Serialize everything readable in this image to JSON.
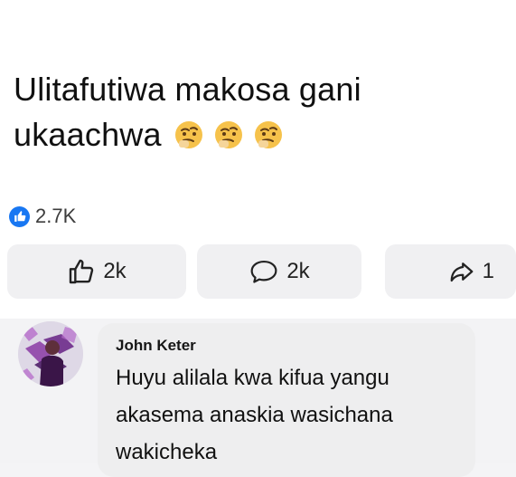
{
  "post": {
    "text": "Ulitafutiwa makosa gani ukaachwa",
    "emoji": [
      "thinking-face",
      "thinking-face",
      "thinking-face"
    ]
  },
  "reactions": {
    "count": "2.7K",
    "type": "like",
    "badge_color": "#1877f2"
  },
  "actions": {
    "like_count": "2k",
    "comment_count": "2k",
    "share_count": "1"
  },
  "comment": {
    "author": "John Keter",
    "text": "Huyu alilala kwa kifua yangu akasema anaskia wasichana wakicheka"
  },
  "colors": {
    "background": "#f4f4f6",
    "post_background": "#ffffff",
    "button_background": "#f0f0f2",
    "comment_bubble": "#eeeeef",
    "text_primary": "#111111",
    "brand_blue": "#1877f2"
  }
}
